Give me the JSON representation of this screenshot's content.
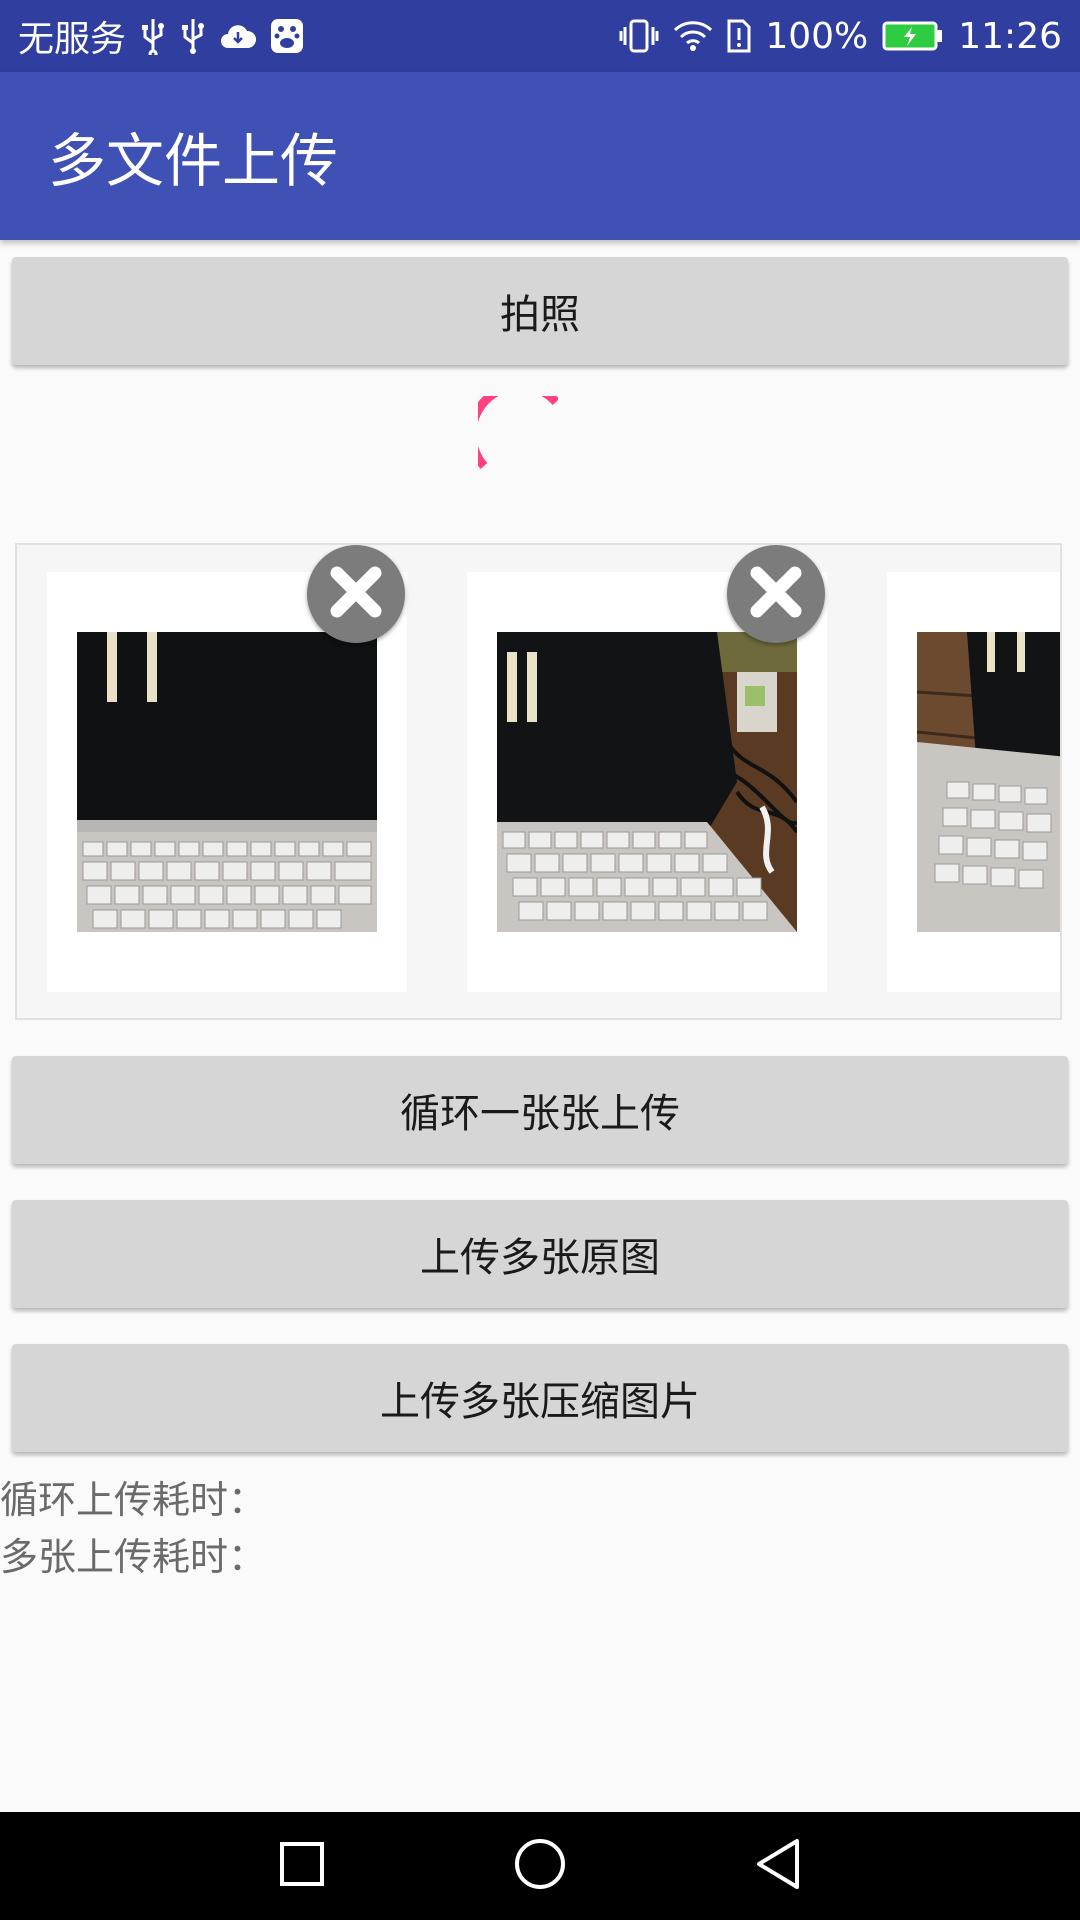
{
  "status_bar": {
    "carrier": "无服务",
    "battery_percent": "100%",
    "time": "11:26",
    "icons": [
      "usb-icon",
      "usb-icon",
      "cloud-icon",
      "baidu-icon",
      "vibrate-icon",
      "wifi-icon",
      "sim-alert-icon",
      "battery-charging-icon"
    ]
  },
  "app_bar": {
    "title": "多文件上传"
  },
  "buttons": {
    "take_photo": "拍照",
    "loop_upload": "循环一张张上传",
    "upload_originals": "上传多张原图",
    "upload_compressed": "上传多张压缩图片"
  },
  "loading_indicator": {
    "color": "#ff4081"
  },
  "gallery": {
    "items": [
      {
        "kind": "photo",
        "subject": "laptop keyboard photo",
        "has_delete": true
      },
      {
        "kind": "photo",
        "subject": "laptop keyboard photo",
        "has_delete": true
      },
      {
        "kind": "photo",
        "subject": "laptop keyboard photo",
        "has_delete": false
      }
    ]
  },
  "info": {
    "loop_time_label": "循环上传耗时：",
    "multi_time_label": "多张上传耗时："
  },
  "colors": {
    "status_bar": "#303f9f",
    "app_bar": "#3f51b5",
    "accent": "#ff4081",
    "button_bg": "#d6d6d6"
  },
  "nav_bar": {
    "icons": [
      "recents-icon",
      "home-icon",
      "back-icon"
    ]
  }
}
